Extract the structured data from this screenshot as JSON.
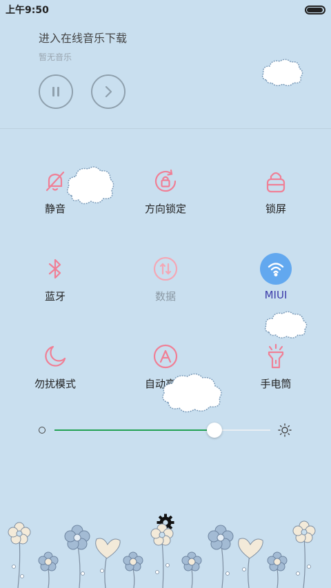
{
  "status_bar": {
    "time": "上午9:50",
    "battery_level": 0.95
  },
  "music": {
    "title": "进入在线音乐下载",
    "subtitle": "暂无音乐"
  },
  "toggles": [
    {
      "label": "静音",
      "icon": "bell-mute-icon"
    },
    {
      "label": "方向锁定",
      "icon": "rotation-lock-icon"
    },
    {
      "label": "锁屏",
      "icon": "lock-icon"
    },
    {
      "label": "蓝牙",
      "icon": "bluetooth-icon"
    },
    {
      "label": "数据",
      "icon": "mobile-data-icon"
    },
    {
      "label": "MIUI",
      "icon": "wifi-icon"
    },
    {
      "label": "勿扰模式",
      "icon": "moon-icon"
    },
    {
      "label": "自动亮度",
      "icon": "auto-brightness-icon"
    },
    {
      "label": "手电筒",
      "icon": "flashlight-icon"
    }
  ],
  "brightness": {
    "level": 0.74
  },
  "colors": {
    "background": "#c9dfef",
    "accent_pink": "#f07f95",
    "wifi_active": "#62a8ef",
    "slider_green": "#21a152"
  }
}
